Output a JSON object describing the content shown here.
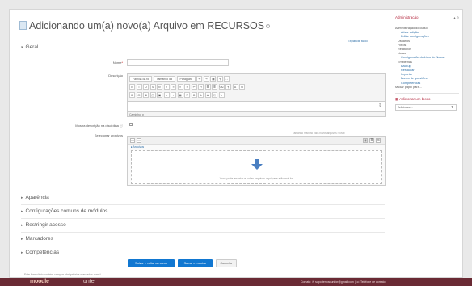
{
  "page_title": "Adicionando um(a) novo(a) Arquivo em RECURSOS",
  "expand_all": "Expandir tudo",
  "sections": {
    "general": "Geral",
    "appearance": "Aparência",
    "common_module_settings": "Configurações comuns de módulos",
    "restrict_access": "Restringir acesso",
    "tags": "Marcadores",
    "competencies": "Competências"
  },
  "fields": {
    "name_label": "Nome",
    "name_value": "",
    "description_label": "Descrição",
    "show_description_label": "Mostra descrição na disciplina",
    "select_files_label": "Selecionar arquivos",
    "required_mark": "*"
  },
  "editor": {
    "font_family": "Família da fo",
    "font_size": "Tamanho da",
    "paragraph": "Parágrafo",
    "path": "Caminho: p",
    "row1_buttons": [
      "↶",
      "↷",
      "▦",
      "¶",
      "⛶"
    ],
    "row2_buttons": [
      "B",
      "I",
      "U",
      "S",
      "x²",
      "≡",
      "≡",
      "≡",
      "≡",
      "↩",
      "↪",
      "≣",
      "≣",
      "⌫",
      "¶",
      "A",
      "Ω"
    ],
    "row3_buttons": [
      "⊞",
      "⊟",
      "⊠",
      "◫",
      "▣",
      "☺",
      "⌖",
      "▦",
      "⚑",
      "Ω",
      "⊕",
      "⊗",
      "⎘",
      "✎"
    ]
  },
  "filepicker": {
    "size_note": "Tamanho máximo para novos arquivos: 60Mb",
    "path": "▸ Arquivos",
    "drop_text": "Você pode arrastar e soltar arquivos aqui para adicioná-los"
  },
  "buttons": {
    "save_return": "Salvar e voltar ao curso",
    "save_show": "Salvar e mostrar",
    "cancel": "Cancelar"
  },
  "required_note": "Este formulário contém campos obrigatórios marcados com *",
  "footer": {
    "logo": "moodle",
    "partner": "unte",
    "contact": "Contato:  ✉ suporteneadunifor@gmail.com  |  ☏ Telefone de contato"
  },
  "sidebar": {
    "admin_title": "Administração",
    "items": [
      {
        "label": "Administração do curso",
        "level": 1
      },
      {
        "label": "Ativar edição",
        "level": 3
      },
      {
        "label": "Editar configurações",
        "level": 3
      },
      {
        "label": "Usuários",
        "level": 2
      },
      {
        "label": "Filtros",
        "level": 2
      },
      {
        "label": "Relatórios",
        "level": 2
      },
      {
        "label": "Notas",
        "level": 2
      },
      {
        "label": "Configuração do Livro de Notas",
        "level": 3
      },
      {
        "label": "Emblemas",
        "level": 2
      },
      {
        "label": "Backup",
        "level": 3
      },
      {
        "label": "Restaurar",
        "level": 3
      },
      {
        "label": "Importar",
        "level": 3
      },
      {
        "label": "Banco de questões",
        "level": 3
      },
      {
        "label": "Competências",
        "level": 3
      },
      {
        "label": "Mudar papel para...",
        "level": 1
      }
    ],
    "add_block_title": "Adicionar um bloco",
    "add_block_select": "Adicionar..."
  },
  "colors": {
    "primary_button": "#1177d1",
    "footer_bg": "#6a2a34",
    "block_title": "#b3263d"
  }
}
